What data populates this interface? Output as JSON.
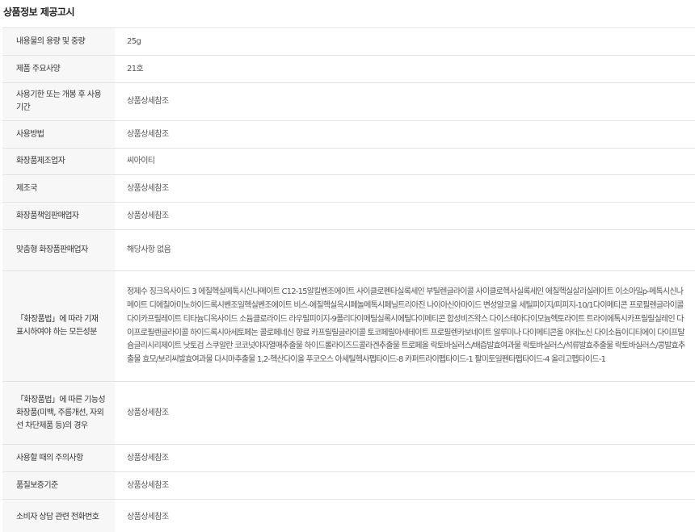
{
  "title": "상품정보 제공고시",
  "rows": [
    {
      "label": "내용물의 용량 및 중량",
      "value": "25g"
    },
    {
      "label": "제품 주요사양",
      "value": "21호"
    },
    {
      "label": "사용기한 또는 개봉 후 사용기간",
      "value": "상품상세참조"
    },
    {
      "label": "사용방법",
      "value": "상품상세참조"
    },
    {
      "label": "화장품제조업자",
      "value": "씨아이티"
    },
    {
      "label": "제조국",
      "value": "상품상세참조"
    },
    {
      "label": "화장품책임판매업자",
      "value": "상품상세참조"
    },
    {
      "label": "맞춤형 화장품판매업자",
      "value": "해당사항 없음"
    },
    {
      "label": "「화장품법」에 따라 기재 표시하여야 하는 모든성분",
      "value": "정제수 징크옥사이드 3 에칠헥실메톡시신나메이트 C12-15알킬벤조에이트 사이클로펜타실록세인 부틸렌글라이콜 사이클로헥사실록세인 에칠헥실살리실레이트 이소아밀p-메톡시신나메이트 디에칠아미노하이드록시벤조일헥실벤조에이트 비스-에칠헥실옥시페놀메톡시페닐트리아진 나이아신아마이드 변성알코올 세틸피이지/피피지-10/1다이메티콘 프로필렌글라이콜다이카프릴레이트 티타늄디옥사이드 소듐클로라이드 라우릴피이지-9폴리다이메틸실록시에틸다이메티콘 합성비즈왁스 다이스테아다이모늄헥토라이트 트라이에톡시카프릴릴실레인 다이프로필렌글라이콜 하이드록시아세토페논 콜로페네신 향료 카프릴릴글라이콜 토코페릴아세테이트 프로필렌카보네이트 알루미나 다이메티콘올 아데노신 다이소듐이디티에이 다이프탈슘글리시리제이트 낫토검 스쿠알란 코코넛야자열매추출물 하이드롤라이즈드콜라겐추출물 트로페올 락토바실러스/배즙발효여과물 락토바실러스/석류발효추출물 락토바실러스/콩발효추출물 효모/보리씨발효여과물 다시마추출물 1,2-헥산다이올 푸코오스 아세틸헥사펩타이드-8 카퍼트라이펩타이드-1 팔미토일펜타펩타이드-4 올리고펩타이드-1"
    },
    {
      "label": "「화장품법」에 따른 기능성 화장품(미백, 주름개선, 자외선 차단제품 등)의 경우",
      "value": "상품상세참조"
    },
    {
      "label": "사용할 때의 주의사항",
      "value": "상품상세참조"
    },
    {
      "label": "품질보증기준",
      "value": "상품상세참조"
    },
    {
      "label": "소비자 상담 관련 전화번호",
      "value": "상품상세참조"
    }
  ]
}
